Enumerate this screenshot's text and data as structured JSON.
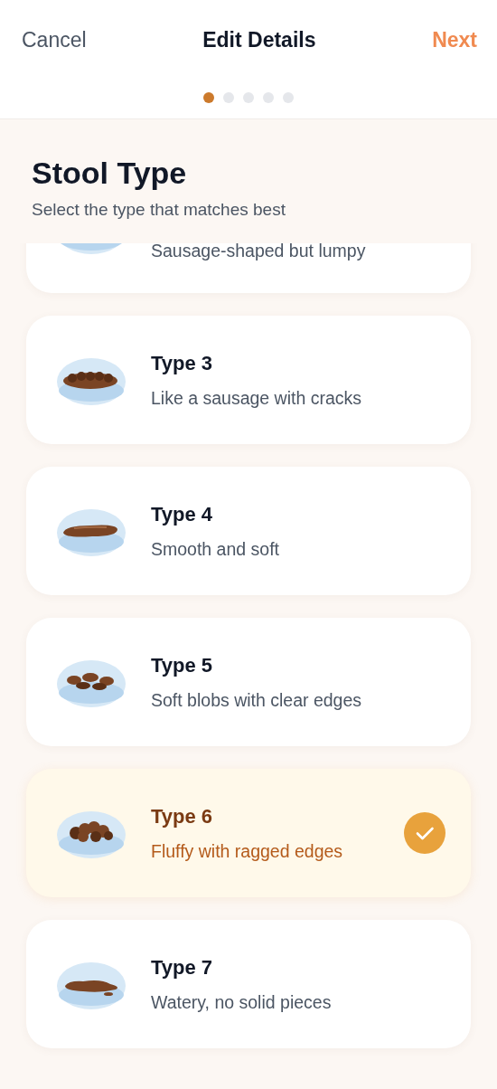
{
  "nav": {
    "cancel": "Cancel",
    "title": "Edit Details",
    "next": "Next"
  },
  "steps": [
    {
      "selected": true
    },
    {
      "selected": false
    },
    {
      "selected": false
    },
    {
      "selected": false
    },
    {
      "selected": false
    }
  ],
  "heading": {
    "title": "Stool Type",
    "subtitle": "Select the type that matches best"
  },
  "options": [
    {
      "kind": "lumpy",
      "description": "Sausage-shaped but lumpy",
      "selected": false
    },
    {
      "kind": "cracked",
      "title": "Type 3",
      "description": "Like a sausage with cracks",
      "selected": false
    },
    {
      "kind": "smooth",
      "title": "Type 4",
      "description": "Smooth and soft",
      "selected": false
    },
    {
      "kind": "blobs",
      "title": "Type 5",
      "description": "Soft blobs with clear edges",
      "selected": false
    },
    {
      "kind": "fluffy",
      "title": "Type 6",
      "description": "Fluffy with ragged edges",
      "selected": true
    },
    {
      "kind": "watery",
      "title": "Type 7",
      "description": "Watery, no solid pieces",
      "selected": false
    }
  ]
}
